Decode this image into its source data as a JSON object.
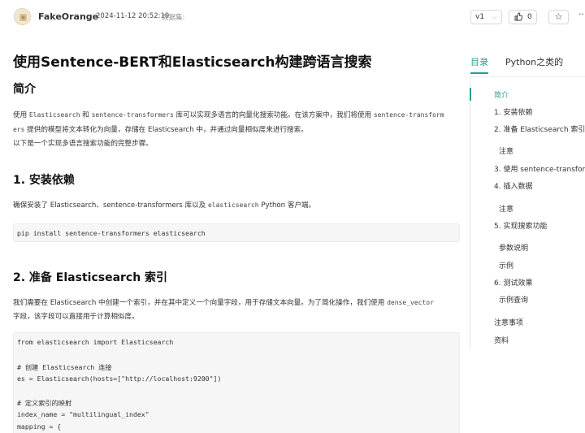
{
  "header": {
    "author": "FakeOrange",
    "date": "2024-11-12 20:52:19",
    "dataset_label": "数据集:",
    "version": "v1",
    "like_count": "0",
    "icons": [
      "avatar",
      "chevron-down-icon",
      "thumb-up-icon",
      "star-icon",
      "more-icon"
    ]
  },
  "article": {
    "title": "使用Sentence-BERT和Elasticsearch构建跨语言搜索",
    "intro_heading": "简介",
    "intro_p1": {
      "a": "使用 ",
      "code1": "Elasticsearch",
      "b": " 和 ",
      "code2": "sentence-transformers",
      "c": " 库可以实现多语言的向量化搜索功能。在该方案中，我们将使用 ",
      "code3": "sentence-transform",
      "code3b": "ers",
      "d": " 提供的模型将文本转化为向量，存储在 Elasticsearch 中，并通过向量相似度来进行搜索。"
    },
    "intro_p2": "以下是一个实现多语言搜索功能的完整步骤。",
    "h_install": "1. 安装依赖",
    "install_p": {
      "a": "确保安装了 Elasticsearch、sentence-transformers 库以及 ",
      "code": "elasticsearch",
      "b": " Python 客户端。"
    },
    "install_code": "pip install sentence-transformers elasticsearch",
    "h_index": "2. 准备 Elasticsearch 索引",
    "index_p": {
      "a": "我们需要在 Elasticsearch 中创建一个索引，并在其中定义一个向量字段，用于存储文本向量。为了简化操作，我们使用 ",
      "code": "dense_vector",
      "b": "字段，该字段可以直接用于计算相似度。"
    },
    "index_code": [
      "from elasticsearch import Elasticsearch",
      "",
      "# 创建 Elasticsearch 连接",
      "es = Elasticsearch(hosts=[\"http://localhost:9200\"])",
      "",
      "# 定义索引的映射",
      "index_name = \"multilingual_index\"",
      "mapping = {"
    ]
  },
  "sidebar": {
    "tab_toc": "目录",
    "tab_other": "Python之类的",
    "toc": [
      {
        "label": "简介",
        "level": 1,
        "active": true
      },
      {
        "label": "1. 安装依赖",
        "level": 1,
        "active": false
      },
      {
        "label": "2. 准备 Elasticsearch 索引",
        "level": 1,
        "active": false
      },
      {
        "label": "注意",
        "level": 2,
        "active": false
      },
      {
        "label": "3. 使用 sentence-transform...",
        "level": 1,
        "active": false
      },
      {
        "label": "4. 插入数据",
        "level": 1,
        "active": false
      },
      {
        "label": "注意",
        "level": 2,
        "active": false
      },
      {
        "label": "5. 实现搜索功能",
        "level": 1,
        "active": false
      },
      {
        "label": "参数说明",
        "level": 2,
        "active": false
      },
      {
        "label": "示例",
        "level": 2,
        "active": false
      },
      {
        "label": "6. 测试效果",
        "level": 1,
        "active": false
      },
      {
        "label": "示例查询",
        "level": 2,
        "active": false
      },
      {
        "label": "注意事项",
        "level": 1,
        "active": false
      },
      {
        "label": "资料",
        "level": 1,
        "active": false
      }
    ]
  },
  "colors": {
    "accent": "#2b9d8f",
    "code_bg": "#f6f6f6"
  }
}
